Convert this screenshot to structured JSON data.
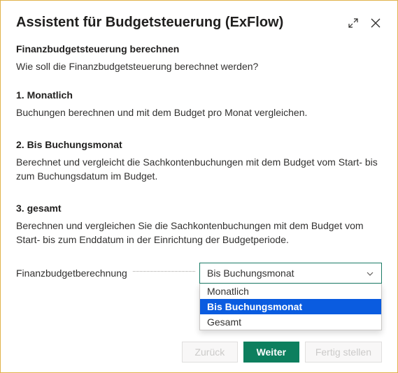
{
  "header": {
    "title": "Assistent für Budgetsteuerung (ExFlow)"
  },
  "section_intro": {
    "heading": "Finanzbudgetsteuerung berechnen",
    "text": "Wie soll die Finanzbudgetsteuerung berechnet werden?"
  },
  "sections": [
    {
      "heading": "1. Monatlich",
      "text": "Buchungen berechnen und mit dem Budget pro Monat vergleichen."
    },
    {
      "heading": "2. Bis Buchungsmonat",
      "text": "Berechnet und vergleicht die Sachkontenbuchungen mit dem Budget vom Start- bis zum Buchungsdatum im Budget."
    },
    {
      "heading": "3. gesamt",
      "text": "Berechnen und vergleichen Sie die Sachkontenbuchungen mit dem Budget vom Start- bis zum Enddatum in der Einrichtung der Budgetperiode."
    }
  ],
  "field": {
    "label": "Finanzbudgetberechnung",
    "value": "Bis Buchungsmonat",
    "options": [
      "Monatlich",
      "Bis Buchungsmonat",
      "Gesamt"
    ]
  },
  "buttons": {
    "back": "Zurück",
    "next": "Weiter",
    "finish": "Fertig stellen"
  }
}
